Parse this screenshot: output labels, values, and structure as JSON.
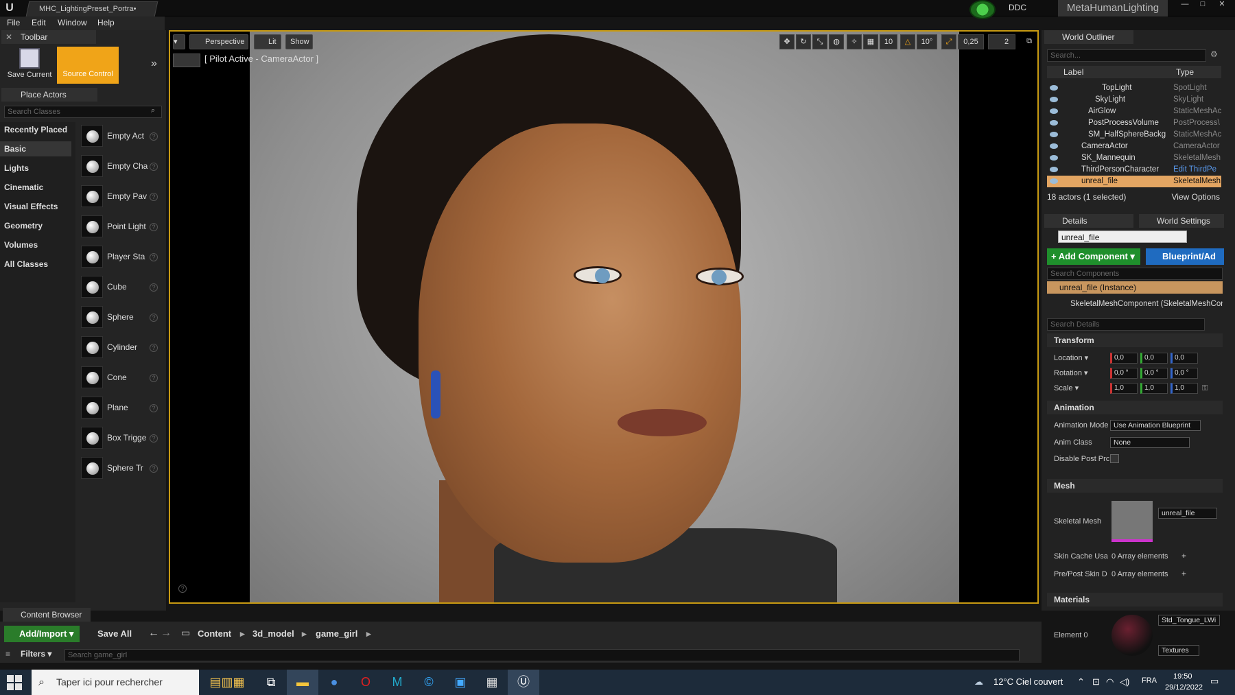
{
  "title_bar": {
    "logo": "U",
    "doc_tab": "MHC_LightingPreset_Portra•",
    "ddc": "DDC",
    "project": "MetaHumanLighting",
    "window_buttons": [
      "—",
      "□",
      "✕"
    ]
  },
  "menu": [
    "File",
    "Edit",
    "Window",
    "Help"
  ],
  "toolbar": {
    "tab": "Toolbar",
    "save_current": "Save Current",
    "source_control": "Source Control",
    "more": "»"
  },
  "place_actors": {
    "tab": "Place Actors",
    "search_placeholder": "Search Classes",
    "categories": [
      "Recently Placed",
      "Basic",
      "Lights",
      "Cinematic",
      "Visual Effects",
      "Geometry",
      "Volumes",
      "All Classes"
    ],
    "selected_category": "Basic",
    "items": [
      "Empty Act",
      "Empty Cha",
      "Empty Pav",
      "Point Light",
      "Player Sta",
      "Cube",
      "Sphere",
      "Cylinder",
      "Cone",
      "Plane",
      "Box Trigge",
      "Sphere Tr"
    ]
  },
  "viewport": {
    "perspective": "Perspective",
    "lit": "Lit",
    "show": "Show",
    "pilot": "[ Pilot Active - CameraActor ]",
    "grid_snap": "10",
    "rot_snap": "10°",
    "scale_snap": "0,25",
    "cam_speed": "2"
  },
  "outliner": {
    "tab": "World Outliner",
    "search_placeholder": "Search...",
    "col_label": "Label",
    "col_type": "Type",
    "rows": [
      {
        "name": "TopLight",
        "type": "SpotLight",
        "indent": 80
      },
      {
        "name": "SkyLight",
        "type": "SkyLight",
        "indent": 70
      },
      {
        "name": "AirGlow",
        "type": "StaticMeshAc",
        "indent": 60
      },
      {
        "name": "PostProcessVolume",
        "type": "PostProcess\\",
        "indent": 60
      },
      {
        "name": "SM_HalfSphereBackg",
        "type": "StaticMeshAc",
        "indent": 60
      },
      {
        "name": "CameraActor",
        "type": "CameraActor",
        "indent": 50
      },
      {
        "name": "SK_Mannequin",
        "type": "SkeletalMesh",
        "indent": 50
      },
      {
        "name": "ThirdPersonCharacter",
        "type": "Edit ThirdPe",
        "indent": 50
      },
      {
        "name": "unreal_file",
        "type": "SkeletalMesh",
        "indent": 50
      }
    ],
    "footer": "18 actors (1 selected)",
    "view_options": "View Options"
  },
  "details": {
    "tab": "Details",
    "world_settings": "World Settings",
    "name": "unreal_file",
    "add_component": "+ Add Component ▾",
    "blueprint": "Blueprint/Ad",
    "search_components": "Search Components",
    "instance": "unreal_file (Instance)",
    "component": "SkeletalMeshComponent (SkeletalMeshCompo",
    "search_details": "Search Details",
    "transform": {
      "header": "Transform",
      "location_label": "Location ▾",
      "rotation_label": "Rotation ▾",
      "scale_label": "Scale ▾",
      "location": [
        "0,0",
        "0,0",
        "0,0"
      ],
      "rotation": [
        "0,0 °",
        "0,0 °",
        "0,0 °"
      ],
      "scale": [
        "1,0",
        "1,0",
        "1,0"
      ]
    },
    "animation": {
      "header": "Animation",
      "mode_label": "Animation Mode",
      "mode": "Use Animation Blueprint",
      "class_label": "Anim Class",
      "class": "None",
      "disable_label": "Disable Post Prc"
    },
    "mesh": {
      "header": "Mesh",
      "skeletal_label": "Skeletal Mesh",
      "skeletal": "unreal_file",
      "skin_cache_label": "Skin Cache Usa",
      "skin_cache": "0 Array elements",
      "pre_post_label": "Pre/Post Skin D",
      "pre_post": "0 Array elements"
    },
    "materials": {
      "header": "Materials",
      "element_label": "Element 0",
      "material": "Std_Tongue_LWi",
      "textures": "Textures"
    }
  },
  "content_browser": {
    "tab": "Content Browser",
    "add_import": "Add/Import ▾",
    "save_all": "Save All",
    "path": [
      "Content",
      "3d_model",
      "game_girl"
    ],
    "filters": "Filters ▾",
    "search_placeholder": "Search game_girl"
  },
  "taskbar": {
    "search": "Taper ici pour rechercher",
    "weather": "12°C  Ciel couvert",
    "lang": "FRA",
    "time": "19:50",
    "date": "29/12/2022"
  }
}
